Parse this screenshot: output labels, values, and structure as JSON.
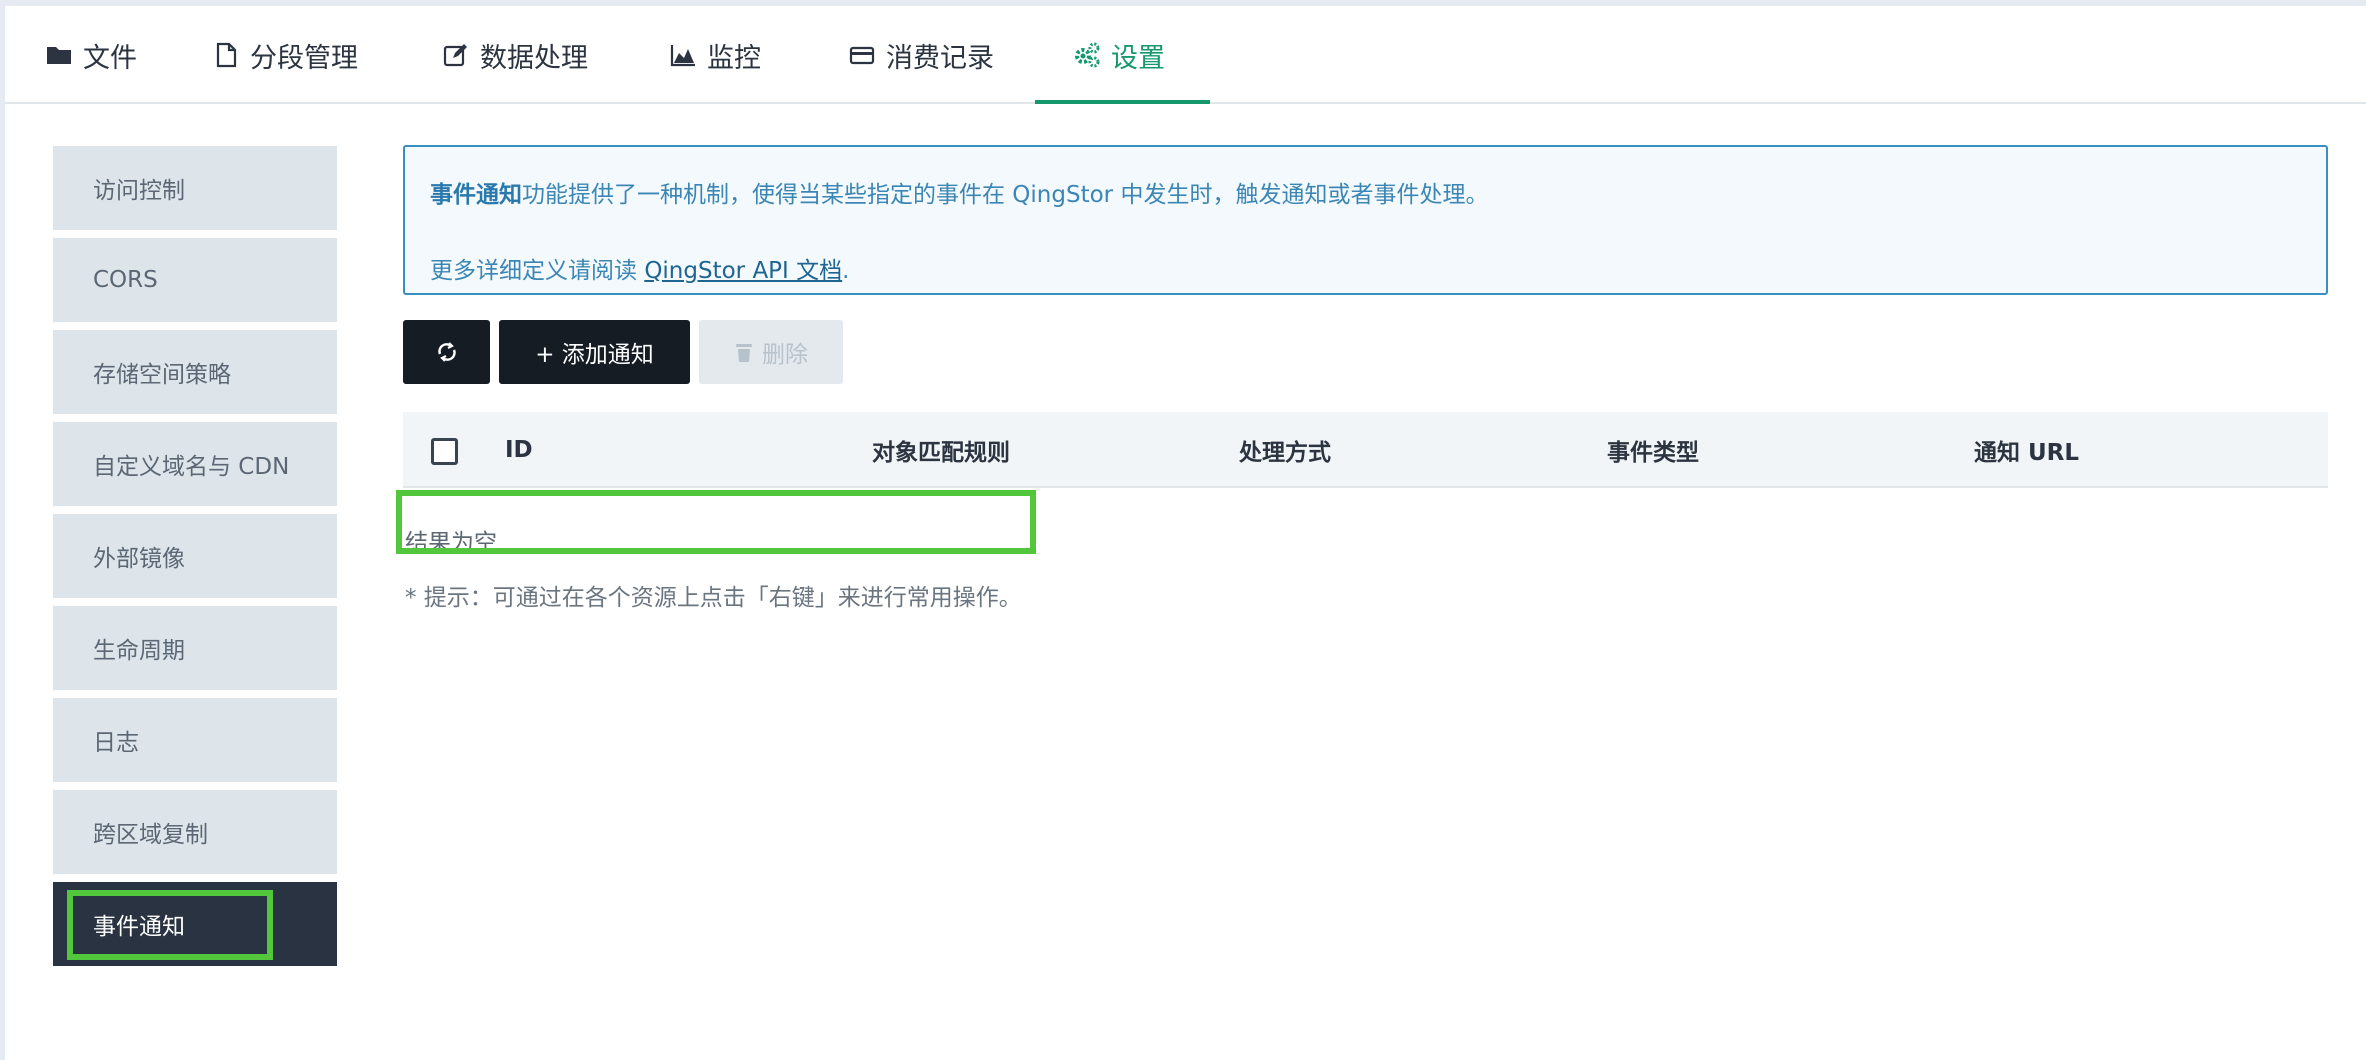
{
  "tabs": [
    {
      "label": "文件",
      "icon": "folder-icon"
    },
    {
      "label": "分段管理",
      "icon": "file-icon"
    },
    {
      "label": "数据处理",
      "icon": "edit-icon"
    },
    {
      "label": "监控",
      "icon": "area-chart-icon"
    },
    {
      "label": "消费记录",
      "icon": "credit-card-icon"
    },
    {
      "label": "设置",
      "icon": "gears-icon",
      "active": true
    }
  ],
  "sidebar": {
    "items": [
      {
        "label": "访问控制"
      },
      {
        "label": "CORS"
      },
      {
        "label": "存储空间策略"
      },
      {
        "label": "自定义域名与 CDN"
      },
      {
        "label": "外部镜像"
      },
      {
        "label": "生命周期"
      },
      {
        "label": "日志"
      },
      {
        "label": "跨区域复制"
      },
      {
        "label": "事件通知",
        "active": true
      }
    ]
  },
  "info": {
    "strong": "事件通知",
    "line1_rest": "功能提供了一种机制，使得当某些指定的事件在 QingStor 中发生时，触发通知或者事件处理。",
    "line2_prefix": "更多详细定义请阅读 ",
    "link": "QingStor API 文档",
    "line2_suffix": "."
  },
  "toolbar": {
    "refresh_icon": "refresh-icon",
    "add_label": "+ 添加通知",
    "delete_icon": "trash-icon",
    "delete_label": "删除"
  },
  "table": {
    "columns": [
      "ID",
      "对象匹配规则",
      "处理方式",
      "事件类型",
      "通知 URL"
    ],
    "rows": [],
    "empty_text": "结果为空"
  },
  "hint": "* 提示：可通过在各个资源上点击「右键」来进行常用操作。",
  "colors": {
    "accent": "#15996c",
    "sidebar_active": "#2a3342",
    "info_border": "#3a8fc2",
    "highlight": "#52c73c"
  }
}
